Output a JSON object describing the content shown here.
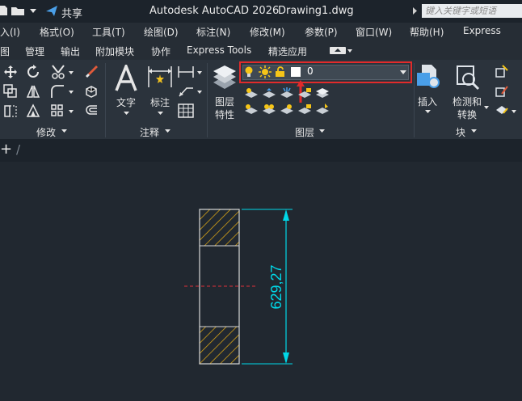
{
  "titlebar": {
    "share": "共享",
    "app_title": "Autodesk AutoCAD 2026",
    "file_name": "Drawing1.dwg",
    "search_placeholder": "键入关键字或短语"
  },
  "menu": [
    "入(I)",
    "格式(O)",
    "工具(T)",
    "绘图(D)",
    "标注(N)",
    "修改(M)",
    "参数(P)",
    "窗口(W)",
    "帮助(H)",
    "Express"
  ],
  "ribbon_tabs": [
    "图",
    "管理",
    "输出",
    "附加模块",
    "协作",
    "Express Tools",
    "精选应用"
  ],
  "ribbon": {
    "panels": {
      "modify": "修改",
      "annotation": "注释",
      "layers": "图层",
      "block": "块"
    },
    "text_label": "文字",
    "dimension_label": "标注",
    "layer_props_line1": "图层",
    "layer_props_line2": "特性",
    "insert_label": "插入",
    "detect_line1": "检测和",
    "detect_line2": "转换",
    "current_layer": "0"
  },
  "doc_tab": {
    "add": "+",
    "sep": "/"
  },
  "drawing": {
    "dimension_text": "629,27"
  },
  "colors": {
    "highlight_border": "#e12b2b",
    "dimension": "#00d8e8",
    "hatch": "#d4a017",
    "centerline": "#e0303a"
  }
}
